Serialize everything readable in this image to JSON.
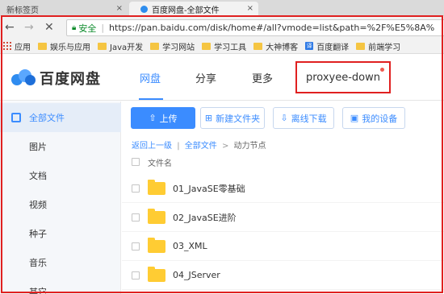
{
  "browser": {
    "tabs": [
      {
        "label": "新标签页"
      },
      {
        "label": "百度网盘-全部文件"
      }
    ],
    "close_glyph": "×",
    "security_label": "安全",
    "url": "https://pan.baidu.com/disk/home#/all?vmode=list&path=%2F%E5%8A%",
    "bookmarks": [
      {
        "label": "应用",
        "icon": "apps-grid-icon"
      },
      {
        "label": "娱乐与应用",
        "icon": "folder-icon"
      },
      {
        "label": "Java开发",
        "icon": "folder-icon"
      },
      {
        "label": "学习网站",
        "icon": "folder-icon"
      },
      {
        "label": "学习工具",
        "icon": "folder-icon"
      },
      {
        "label": "大神博客",
        "icon": "folder-icon"
      },
      {
        "label": "百度翻译",
        "icon": "translate-icon"
      },
      {
        "label": "前端学习",
        "icon": "folder-icon"
      }
    ],
    "translate_glyph": "译"
  },
  "app": {
    "logo_text": "百度网盘",
    "nav": [
      {
        "label": "网盘",
        "active": true
      },
      {
        "label": "分享",
        "active": false
      },
      {
        "label": "更多",
        "active": false
      }
    ],
    "extension_label": "proxyee-down"
  },
  "sidebar": {
    "items": [
      {
        "label": "全部文件",
        "active": true
      },
      {
        "label": "图片"
      },
      {
        "label": "文档"
      },
      {
        "label": "视频"
      },
      {
        "label": "种子"
      },
      {
        "label": "音乐"
      },
      {
        "label": "其它"
      }
    ]
  },
  "toolbar": {
    "upload": "上传",
    "new_folder": "新建文件夹",
    "offline_download": "离线下载",
    "my_devices": "我的设备"
  },
  "breadcrumb": {
    "back": "返回上一级",
    "sep": "|",
    "root": "全部文件",
    "arrow": ">",
    "current": "动力节点"
  },
  "file_list": {
    "column_name": "文件名",
    "files": [
      {
        "name": "01_JavaSE零基础",
        "type": "folder"
      },
      {
        "name": "02_JavaSE进阶",
        "type": "folder"
      },
      {
        "name": "03_XML",
        "type": "folder"
      },
      {
        "name": "04_JServer",
        "type": "folder"
      }
    ]
  },
  "colors": {
    "accent": "#3b8cff",
    "highlight": "#e02020",
    "folder": "#ffcc33"
  }
}
